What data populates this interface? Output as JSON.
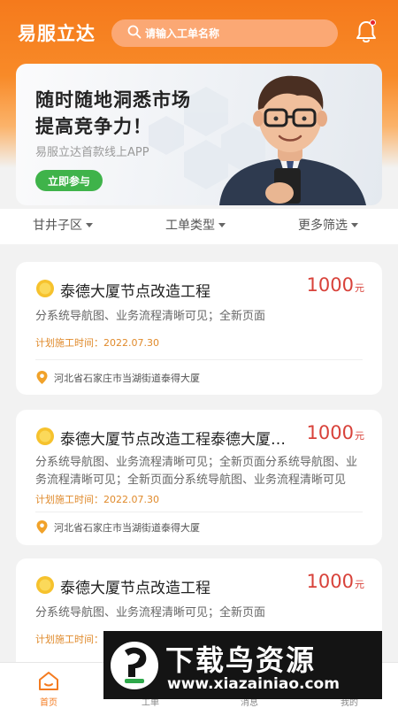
{
  "header": {
    "app_title": "易服立达",
    "search_placeholder": "请输入工单名称",
    "icons": {
      "search": "search-icon",
      "bell": "bell-icon"
    }
  },
  "banner": {
    "headline_line1": "随时随地洞悉市场",
    "headline_line2": "提高竞争力！",
    "subtitle": "易服立达首款线上APP",
    "join_label": "立即参与"
  },
  "filters": [
    {
      "label": "甘井子区"
    },
    {
      "label": "工单类型"
    },
    {
      "label": "更多筛选"
    }
  ],
  "cards": [
    {
      "title": "泰德大厦节点改造工程",
      "price": "1000",
      "unit": "元",
      "description": "分系统导航图、业务流程清晰可见；全新页面",
      "time_label": "计划施工时间：2022.07.30",
      "location": "河北省石家庄市当湖街道泰得大厦"
    },
    {
      "title": "泰德大厦节点改造工程泰德大厦节点改造工程",
      "price": "1000",
      "unit": "元",
      "description": "分系统导航图、业务流程清晰可见；全新页面分系统导航图、业务流程清晰可见；全新页面分系统导航图、业务流程清晰可见",
      "time_label": "计划施工时间：2022.07.30",
      "location": "河北省石家庄市当湖街道泰得大厦"
    },
    {
      "title": "泰德大厦节点改造工程",
      "price": "1000",
      "unit": "元",
      "description": "分系统导航图、业务流程清晰可见；全新页面",
      "time_label": "计划施工时间：2022.07.30",
      "location": ""
    }
  ],
  "tabbar": {
    "items": [
      {
        "label": "首页",
        "icon": "home-icon",
        "active": true
      },
      {
        "label": "工单",
        "icon": "order-icon",
        "active": false
      },
      {
        "label": "消息",
        "icon": "message-icon",
        "active": false
      },
      {
        "label": "我的",
        "icon": "profile-icon",
        "active": false
      }
    ]
  },
  "watermark": {
    "text": "下载鸟资源",
    "url": "www.xiazainiao.com"
  },
  "colors": {
    "brand_orange": "#f57a1c",
    "price_red": "#d8423a",
    "join_green": "#3fb34a",
    "time_orange": "#e08a2b"
  }
}
